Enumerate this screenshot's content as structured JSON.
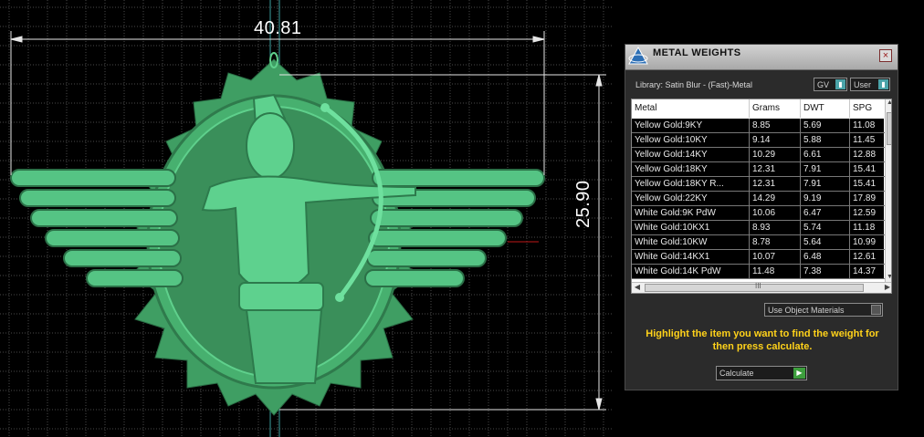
{
  "viewport": {
    "dim_width": "40.81",
    "dim_height": "25.90",
    "model_color": "#4fc27d",
    "grid_color": "#4a4a4a"
  },
  "panel": {
    "title": "METAL WEIGHTS",
    "close_glyph": "×",
    "library_label": "Library: Satin Blur - (Fast)-Metal",
    "gv_label": "GV",
    "user_label": "User",
    "dropdown_glyph": "▮",
    "columns": [
      "Metal",
      "Grams",
      "DWT",
      "SPG"
    ],
    "rows": [
      [
        "Yellow Gold:9KY",
        "8.85",
        "5.69",
        "11.08"
      ],
      [
        "Yellow Gold:10KY",
        "9.14",
        "5.88",
        "11.45"
      ],
      [
        "Yellow Gold:14KY",
        "10.29",
        "6.61",
        "12.88"
      ],
      [
        "Yellow Gold:18KY",
        "12.31",
        "7.91",
        "15.41"
      ],
      [
        "Yellow Gold:18KY R...",
        "12.31",
        "7.91",
        "15.41"
      ],
      [
        "Yellow Gold:22KY",
        "14.29",
        "9.19",
        "17.89"
      ],
      [
        "White Gold:9K PdW",
        "10.06",
        "6.47",
        "12.59"
      ],
      [
        "White Gold:10KX1",
        "8.93",
        "5.74",
        "11.18"
      ],
      [
        "White Gold:10KW",
        "8.78",
        "5.64",
        "10.99"
      ],
      [
        "White Gold:14KX1",
        "10.07",
        "6.48",
        "12.61"
      ],
      [
        "White Gold:14K PdW",
        "11.48",
        "7.38",
        "14.37"
      ]
    ],
    "hscroll_grip": "III",
    "materials_label": "Use Object Materials",
    "instructions": "Highlight the item you want to find the weight for then press calculate.",
    "calculate_label": "Calculate",
    "calculate_glyph": "▶",
    "accent_color": "#ffd21a"
  }
}
